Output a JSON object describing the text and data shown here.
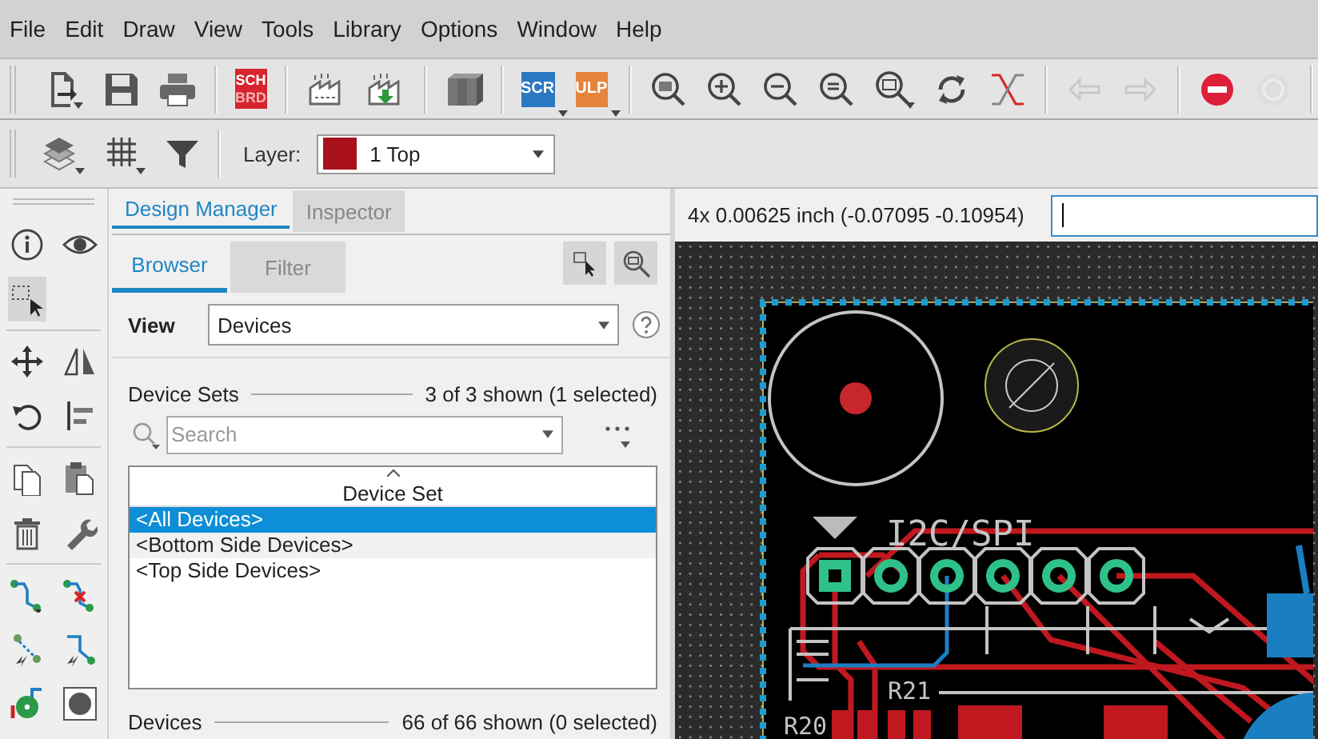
{
  "menu": [
    "File",
    "Edit",
    "Draw",
    "View",
    "Tools",
    "Library",
    "Options",
    "Window",
    "Help"
  ],
  "toolbar": {
    "switch_button": {
      "lines": [
        "SCH",
        "BRD"
      ]
    },
    "script_buttons": [
      {
        "label": "SCR",
        "color": "#2b78c2"
      },
      {
        "label": "ULP",
        "color": "#e5843c"
      }
    ],
    "history_buttons": [
      {
        "kind": "undo",
        "disabled": true
      },
      {
        "kind": "redo",
        "disabled": true
      }
    ],
    "run_buttons": [
      {
        "kind": "stop",
        "disabled": false
      },
      {
        "kind": "go",
        "disabled": true
      }
    ]
  },
  "layer_bar": {
    "label": "Layer:",
    "layer": {
      "value": "1 Top",
      "color": "#a8111a"
    }
  },
  "panel": {
    "tabs": [
      {
        "label": "Design Manager",
        "selected": true
      },
      {
        "label": "Inspector",
        "selected": false
      }
    ],
    "subtabs": [
      {
        "label": "Browser",
        "selected": true
      },
      {
        "label": "Filter",
        "selected": false
      }
    ],
    "view": {
      "label": "View",
      "value": "Devices"
    },
    "device_sets": {
      "title": "Device Sets",
      "count": "3 of 3 shown (1 selected)",
      "search": {
        "placeholder": "Search"
      },
      "column": "Device Set",
      "rows": [
        {
          "label": "<All Devices>",
          "selected": true
        },
        {
          "label": "<Bottom Side Devices>",
          "selected": false
        },
        {
          "label": "<Top Side Devices>",
          "selected": false
        }
      ]
    },
    "devices": {
      "title": "Devices",
      "count": "66 of 66 shown (0 selected)"
    }
  },
  "canvas": {
    "status": "4x 0.00625 inch (-0.07095 -0.10954)",
    "board_labels": [
      {
        "text": "I2C/SPI"
      },
      {
        "text": "R21"
      },
      {
        "text": "R20"
      }
    ]
  }
}
